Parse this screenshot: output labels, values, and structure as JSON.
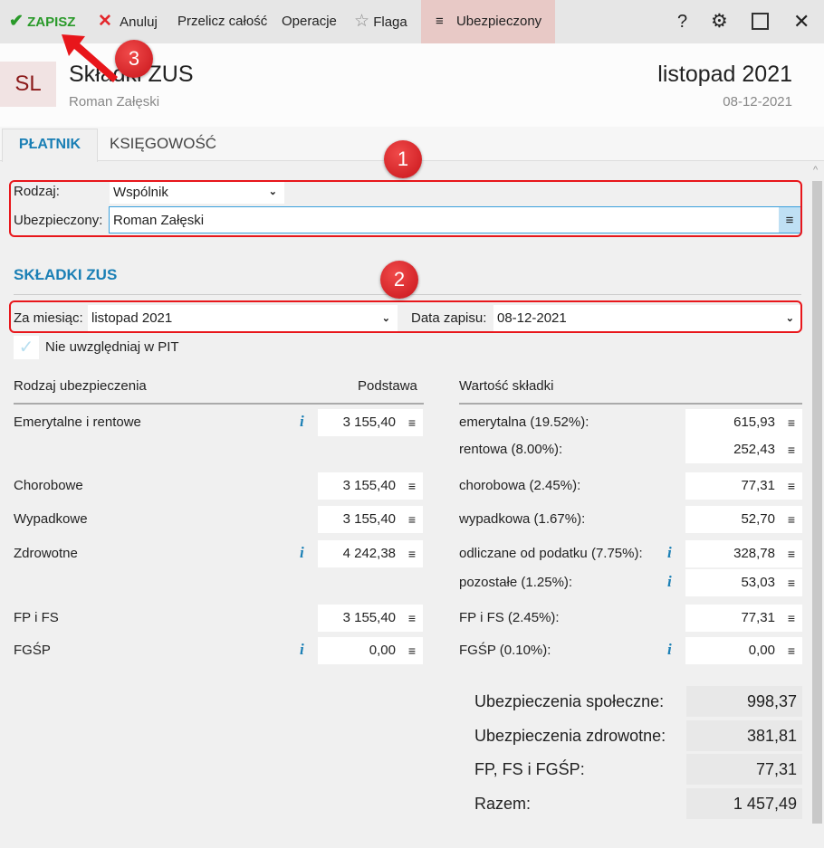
{
  "toolbar": {
    "save": "ZAPISZ",
    "cancel": "Anuluj",
    "recalc": "Przelicz całość",
    "operations": "Operacje",
    "flag": "Flaga",
    "insured": "Ubezpieczony",
    "help": "?"
  },
  "header": {
    "initials": "SL",
    "title": "Składki ZUS",
    "subtitle": "Roman Załęski",
    "period": "listopad 2021",
    "date": "08-12-2021"
  },
  "tabs": [
    {
      "label": "PŁATNIK",
      "active": true
    },
    {
      "label": "KSIĘGOWOŚĆ",
      "active": false
    }
  ],
  "form": {
    "rodzaj_label": "Rodzaj:",
    "rodzaj_value": "Wspólnik",
    "ubezp_label": "Ubezpieczony:",
    "ubezp_value": "Roman Załęski"
  },
  "section_title": "SKŁADKI ZUS",
  "period": {
    "month_label": "Za miesiąc:",
    "month_value": "listopad 2021",
    "date_label": "Data zapisu:",
    "date_value": "08-12-2021"
  },
  "pit_checkbox": {
    "label": "Nie uwzględniaj w PIT",
    "checked": false
  },
  "columns": {
    "type": "Rodzaj ubezpieczenia",
    "base": "Podstawa",
    "value": "Wartość składki"
  },
  "rows": [
    {
      "name": "Emerytalne i rentowe",
      "base": "3 155,40",
      "info": true,
      "items": [
        {
          "label": "emerytalna (19.52%):",
          "value": "615,93"
        },
        {
          "label": "rentowa (8.00%):",
          "value": "252,43"
        }
      ]
    },
    {
      "name": "Chorobowe",
      "base": "3 155,40",
      "items": [
        {
          "label": "chorobowa (2.45%):",
          "value": "77,31"
        }
      ]
    },
    {
      "name": "Wypadkowe",
      "base": "3 155,40",
      "items": [
        {
          "label": "wypadkowa (1.67%):",
          "value": "52,70"
        }
      ]
    },
    {
      "name": "Zdrowotne",
      "base": "4 242,38",
      "info": true,
      "items": [
        {
          "label": "odliczane od podatku (7.75%):",
          "value": "328,78",
          "info": true
        },
        {
          "label": "pozostałe (1.25%):",
          "value": "53,03",
          "info": true
        }
      ]
    },
    {
      "name": "FP i FS",
      "base": "3 155,40",
      "items": [
        {
          "label": "FP i FS (2.45%):",
          "value": "77,31"
        }
      ]
    },
    {
      "name": "FGŚP",
      "base": "0,00",
      "info": true,
      "items": [
        {
          "label": "FGŚP (0.10%):",
          "value": "0,00",
          "info": true
        }
      ]
    }
  ],
  "summary": [
    {
      "label": "Ubezpieczenia społeczne:",
      "value": "998,37"
    },
    {
      "label": "Ubezpieczenia zdrowotne:",
      "value": "381,81"
    },
    {
      "label": "FP, FS i FGŚP:",
      "value": "77,31"
    },
    {
      "label": "Razem:",
      "value": "1 457,49"
    }
  ],
  "annotations": [
    "1",
    "2",
    "3"
  ],
  "colors": {
    "accent": "#1a7fb5",
    "save": "#2a9a2a",
    "cancel": "#e3262b",
    "annotation": "#e8161b",
    "insured_tab": "#e8c9c6"
  }
}
